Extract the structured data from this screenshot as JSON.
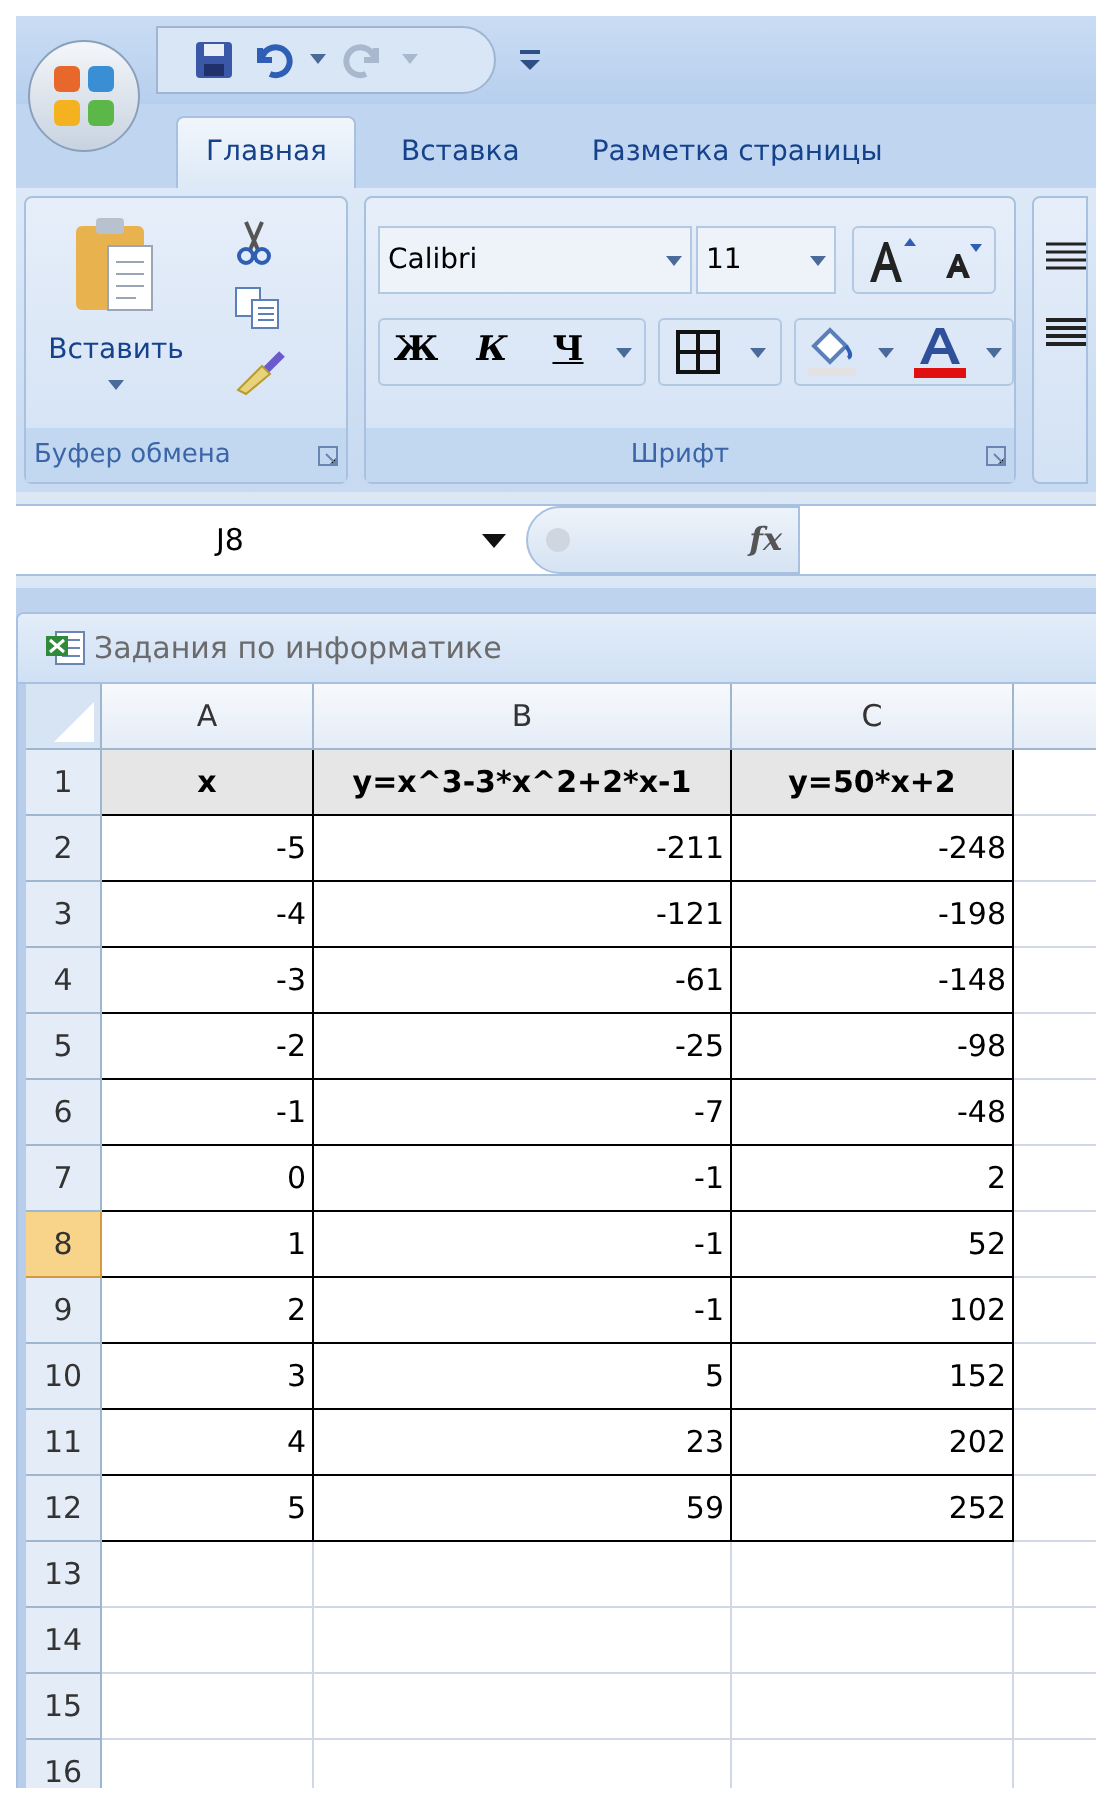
{
  "tabs": [
    {
      "label": "Главная",
      "selected": true
    },
    {
      "label": "Вставка",
      "selected": false
    },
    {
      "label": "Разметка страницы",
      "selected": false
    }
  ],
  "ribbon": {
    "paste_label": "Вставить",
    "font_name": "Calibri",
    "font_size": "11",
    "bold_label": "Ж",
    "italic_label": "К",
    "underline_label": "Ч",
    "groups": [
      "Буфер обмена",
      "Шрифт"
    ]
  },
  "formula_bar": {
    "name_box": "J8",
    "function_label": "fx"
  },
  "workbook_title": "Задания по информатике",
  "columns": [
    "A",
    "B",
    "C"
  ],
  "rows": [
    {
      "number": "1",
      "selected": false,
      "kind": "header",
      "cells": [
        "x",
        "y=x^3-3*x^2+2*x-1",
        "y=50*x+2"
      ]
    },
    {
      "number": "2",
      "selected": false,
      "kind": "data",
      "cells": [
        "-5",
        "-211",
        "-248"
      ]
    },
    {
      "number": "3",
      "selected": false,
      "kind": "data",
      "cells": [
        "-4",
        "-121",
        "-198"
      ]
    },
    {
      "number": "4",
      "selected": false,
      "kind": "data",
      "cells": [
        "-3",
        "-61",
        "-148"
      ]
    },
    {
      "number": "5",
      "selected": false,
      "kind": "data",
      "cells": [
        "-2",
        "-25",
        "-98"
      ]
    },
    {
      "number": "6",
      "selected": false,
      "kind": "data",
      "cells": [
        "-1",
        "-7",
        "-48"
      ]
    },
    {
      "number": "7",
      "selected": false,
      "kind": "data",
      "cells": [
        "0",
        "-1",
        "2"
      ]
    },
    {
      "number": "8",
      "selected": true,
      "kind": "data",
      "cells": [
        "1",
        "-1",
        "52"
      ]
    },
    {
      "number": "9",
      "selected": false,
      "kind": "data",
      "cells": [
        "2",
        "-1",
        "102"
      ]
    },
    {
      "number": "10",
      "selected": false,
      "kind": "data",
      "cells": [
        "3",
        "5",
        "152"
      ]
    },
    {
      "number": "11",
      "selected": false,
      "kind": "data",
      "cells": [
        "4",
        "23",
        "202"
      ]
    },
    {
      "number": "12",
      "selected": false,
      "kind": "data",
      "cells": [
        "5",
        "59",
        "252"
      ]
    },
    {
      "number": "13",
      "selected": false,
      "kind": "empty"
    },
    {
      "number": "14",
      "selected": false,
      "kind": "empty"
    },
    {
      "number": "15",
      "selected": false,
      "kind": "empty"
    },
    {
      "number": "16",
      "selected": false,
      "kind": "empty"
    }
  ]
}
